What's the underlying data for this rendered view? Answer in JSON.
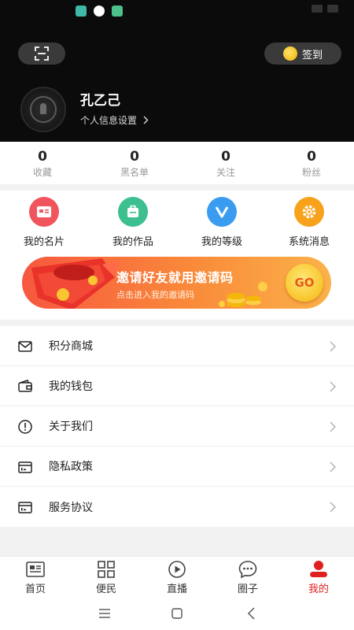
{
  "header": {
    "signin_label": "签到",
    "username": "孔乙己",
    "profile_link": "个人信息设置"
  },
  "stats": [
    {
      "value": "0",
      "label": "收藏"
    },
    {
      "value": "0",
      "label": "黑名单"
    },
    {
      "value": "0",
      "label": "关注"
    },
    {
      "value": "0",
      "label": "粉丝"
    }
  ],
  "quick_actions": [
    {
      "label": "我的名片",
      "icon": "id-card-icon",
      "color": "#f0555e"
    },
    {
      "label": "我的作品",
      "icon": "briefcase-icon",
      "color": "#3dbf8f"
    },
    {
      "label": "我的等级",
      "icon": "v-badge-icon",
      "color": "#3a9cf0"
    },
    {
      "label": "系统消息",
      "icon": "gear-icon",
      "color": "#f8a21b"
    }
  ],
  "banner": {
    "title": "邀请好友就用邀请码",
    "subtitle": "点击进入我的邀请码",
    "go_label": "GO"
  },
  "menu": [
    {
      "label": "积分商城",
      "icon": "envelope-icon"
    },
    {
      "label": "我的钱包",
      "icon": "wallet-icon"
    },
    {
      "label": "关于我们",
      "icon": "info-icon"
    },
    {
      "label": "隐私政策",
      "icon": "document-icon"
    },
    {
      "label": "服务协议",
      "icon": "agreement-icon"
    }
  ],
  "tabs": [
    {
      "label": "首页",
      "icon": "newspaper-icon"
    },
    {
      "label": "便民",
      "icon": "grid-icon"
    },
    {
      "label": "直播",
      "icon": "play-icon"
    },
    {
      "label": "圈子",
      "icon": "chat-icon"
    },
    {
      "label": "我的",
      "icon": "user-icon",
      "active": true
    }
  ],
  "colors": {
    "accent": "#e02020",
    "header_bg": "#0b0b0b",
    "banner_start": "#f7573f",
    "banner_end": "#fbb24a"
  }
}
